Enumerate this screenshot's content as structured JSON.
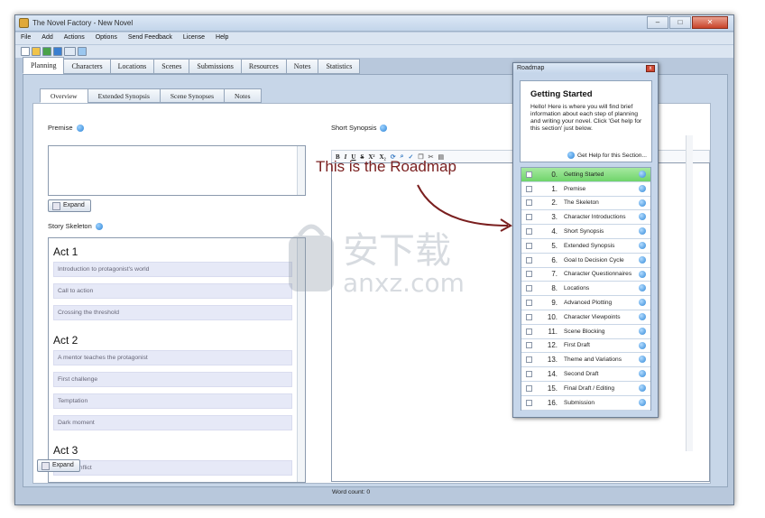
{
  "window": {
    "title": "The Novel Factory - New Novel",
    "minimize": "–",
    "maximize": "□",
    "close": "✕"
  },
  "menu": [
    "File",
    "Add",
    "Actions",
    "Options",
    "Send Feedback",
    "License",
    "Help"
  ],
  "main_tabs": [
    "Planning",
    "Characters",
    "Locations",
    "Scenes",
    "Submissions",
    "Resources",
    "Notes",
    "Statistics"
  ],
  "sub_tabs": [
    "Overview",
    "Extended Synopsis",
    "Scene Synopses",
    "Notes"
  ],
  "premise": {
    "label": "Premise",
    "expand": "Expand"
  },
  "skeleton": {
    "label": "Story Skeleton",
    "expand": "Expand",
    "acts": [
      {
        "title": "Act 1",
        "beats": [
          "Introduction to protagonist's world",
          "Call to action",
          "Crossing the threshold"
        ]
      },
      {
        "title": "Act 2",
        "beats": [
          "A mentor teaches the protagonist",
          "First challenge",
          "Temptation",
          "Dark moment"
        ]
      },
      {
        "title": "Act 3",
        "beats": [
          "Final conflict"
        ]
      }
    ]
  },
  "synopsis": {
    "label": "Short Synopsis",
    "tools": [
      "B",
      "I",
      "U",
      "S",
      "X²",
      "X₂"
    ],
    "word_count": "Word count: 0"
  },
  "annotation": "This is the Roadmap",
  "watermark": {
    "cn": "安下载",
    "en": "anxz.com"
  },
  "roadmap": {
    "title": "Roadmap",
    "heading": "Getting Started",
    "intro": "Hello! Here is where you will find brief information about each step of planning and writing your novel. Click 'Get help for this section' just below.",
    "help_link": "Get Help for this Section...",
    "steps": [
      {
        "num": "0.",
        "name": "Getting Started"
      },
      {
        "num": "1.",
        "name": "Premise"
      },
      {
        "num": "2.",
        "name": "The Skeleton"
      },
      {
        "num": "3.",
        "name": "Character Introductions"
      },
      {
        "num": "4.",
        "name": "Short Synopsis"
      },
      {
        "num": "5.",
        "name": "Extended Synopsis"
      },
      {
        "num": "6.",
        "name": "Goal to Decision Cycle"
      },
      {
        "num": "7.",
        "name": "Character Questionnaires"
      },
      {
        "num": "8.",
        "name": "Locations"
      },
      {
        "num": "9.",
        "name": "Advanced Plotting"
      },
      {
        "num": "10.",
        "name": "Character Viewpoints"
      },
      {
        "num": "11.",
        "name": "Scene Blocking"
      },
      {
        "num": "12.",
        "name": "First Draft"
      },
      {
        "num": "13.",
        "name": "Theme and Variations"
      },
      {
        "num": "14.",
        "name": "Second Draft"
      },
      {
        "num": "15.",
        "name": "Final Draft / Editing"
      },
      {
        "num": "16.",
        "name": "Submission"
      }
    ]
  }
}
